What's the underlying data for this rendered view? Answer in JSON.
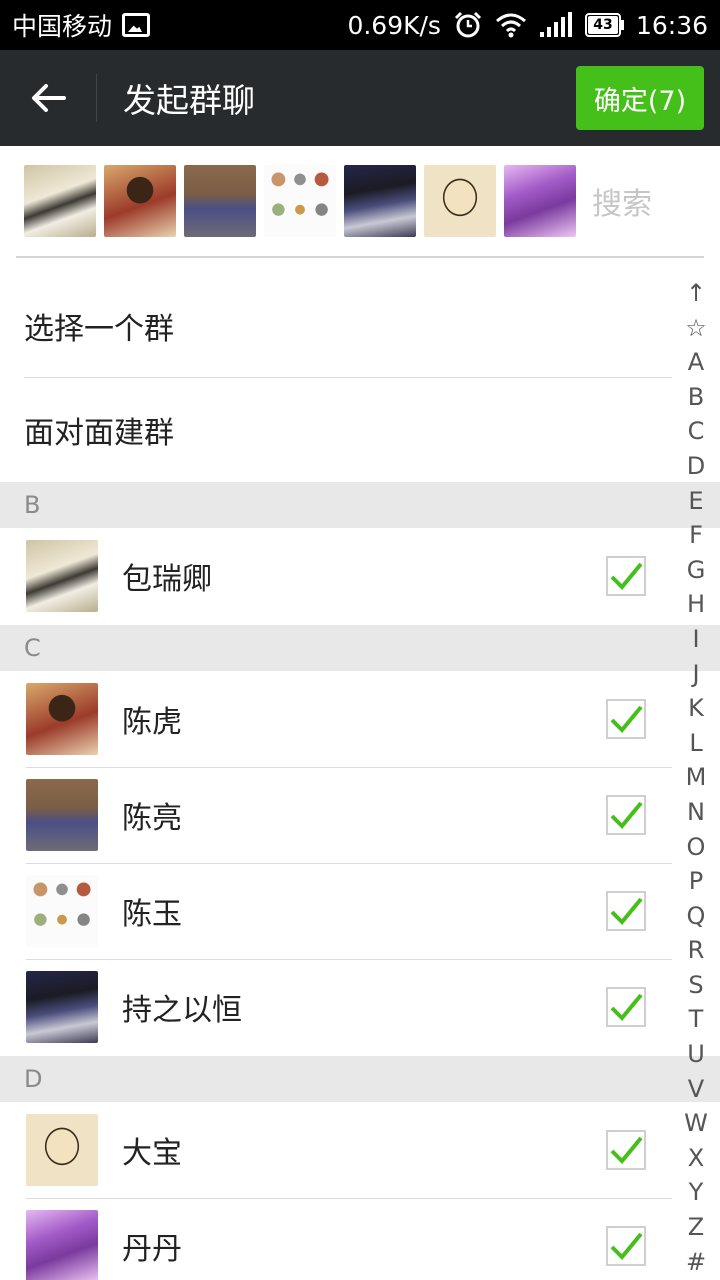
{
  "status_bar": {
    "carrier": "中国移动",
    "speed": "0.69K/s",
    "battery": "43",
    "time": "16:36",
    "icons": [
      "gallery-notification-icon",
      "alarm-icon",
      "wifi-icon",
      "signal-icon",
      "battery-icon"
    ]
  },
  "header": {
    "title": "发起群聊",
    "confirm_label": "确定(7)",
    "back_icon": "arrow-left-icon"
  },
  "search": {
    "placeholder": "搜索"
  },
  "menu": {
    "select_group": "选择一个群",
    "face_to_face": "面对面建群"
  },
  "sections": {
    "b": "B",
    "c": "C",
    "d": "D"
  },
  "contacts": [
    {
      "name": "包瑞卿",
      "checked": true
    },
    {
      "name": "陈虎",
      "checked": true
    },
    {
      "name": "陈亮",
      "checked": true
    },
    {
      "name": "陈玉",
      "checked": true
    },
    {
      "name": "持之以恒",
      "checked": true
    },
    {
      "name": "大宝",
      "checked": true
    },
    {
      "name": "丹丹",
      "checked": true
    }
  ],
  "index_letters": [
    "↑",
    "☆",
    "A",
    "B",
    "C",
    "D",
    "E",
    "F",
    "G",
    "H",
    "I",
    "J",
    "K",
    "L",
    "M",
    "N",
    "O",
    "P",
    "Q",
    "R",
    "S",
    "T",
    "U",
    "V",
    "W",
    "X",
    "Y",
    "Z",
    "#"
  ],
  "colors": {
    "action_bar": "#272b2d",
    "confirm_button": "#45c01a",
    "check_mark": "#45c01a",
    "section_header": "#e8e8e8"
  }
}
